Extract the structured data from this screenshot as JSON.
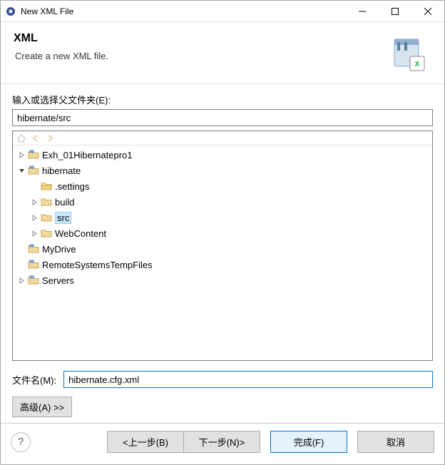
{
  "window": {
    "title": "New XML File"
  },
  "header": {
    "title": "XML",
    "description": "Create a new XML file."
  },
  "form": {
    "parent_label": "输入或选择父文件夹(E):",
    "parent_value": "hibernate/src",
    "filename_label": "文件名(M):",
    "filename_value": "hibernate.cfg.xml",
    "advanced_label": "高级(A) >>"
  },
  "tree": {
    "items": [
      {
        "label": "Exh_01Hibernatepro1",
        "depth": 0,
        "expanded": false,
        "has_children": true,
        "icon": "project",
        "selected": false
      },
      {
        "label": "hibernate",
        "depth": 0,
        "expanded": true,
        "has_children": true,
        "icon": "project",
        "selected": false
      },
      {
        "label": ".settings",
        "depth": 1,
        "expanded": false,
        "has_children": false,
        "icon": "folder-open",
        "selected": false
      },
      {
        "label": "build",
        "depth": 1,
        "expanded": false,
        "has_children": true,
        "icon": "folder",
        "selected": false
      },
      {
        "label": "src",
        "depth": 1,
        "expanded": false,
        "has_children": true,
        "icon": "folder",
        "selected": true
      },
      {
        "label": "WebContent",
        "depth": 1,
        "expanded": false,
        "has_children": true,
        "icon": "folder",
        "selected": false
      },
      {
        "label": "MyDrive",
        "depth": 0,
        "expanded": false,
        "has_children": false,
        "icon": "project",
        "selected": false
      },
      {
        "label": "RemoteSystemsTempFiles",
        "depth": 0,
        "expanded": false,
        "has_children": false,
        "icon": "project-alt",
        "selected": false
      },
      {
        "label": "Servers",
        "depth": 0,
        "expanded": false,
        "has_children": true,
        "icon": "project",
        "selected": false
      }
    ]
  },
  "buttons": {
    "back": "<上一步(B)",
    "next": "下一步(N)>",
    "finish": "完成(F)",
    "cancel": "取消"
  }
}
